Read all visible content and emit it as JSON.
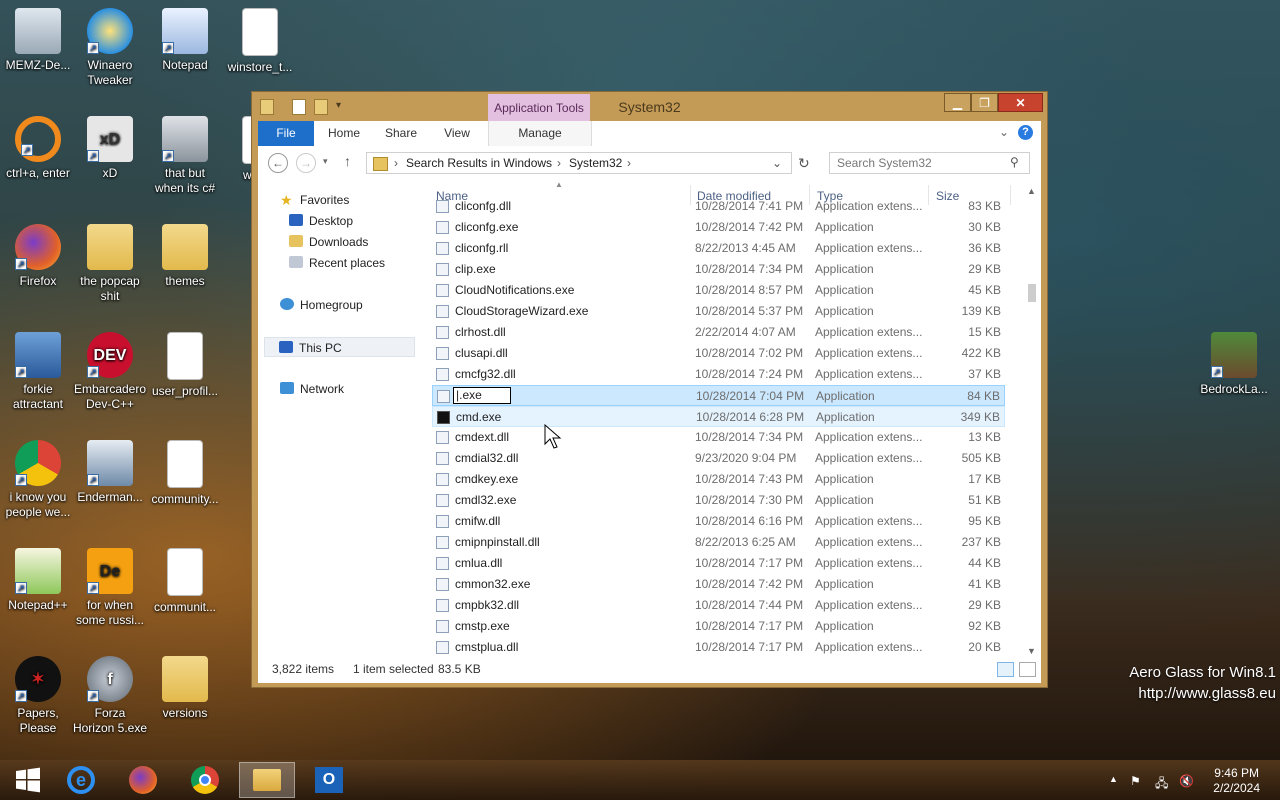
{
  "desktop": {
    "icons": [
      {
        "label": "MEMZ-De...",
        "icon": "recycle-bin-icon"
      },
      {
        "label": "Winaero\nTweaker",
        "icon": "winaero-icon"
      },
      {
        "label": "Notepad",
        "icon": "notepad-icon"
      },
      {
        "label": "winstore_t...",
        "icon": "document-icon"
      },
      {
        "label": "ctrl+a, enter",
        "icon": "orange-app-icon"
      },
      {
        "label": "xD",
        "icon": "hxd-icon"
      },
      {
        "label": "that but\nwhen its c#",
        "icon": "window-stack-icon"
      },
      {
        "label": "wins...",
        "icon": "document-icon"
      },
      {
        "label": "Firefox",
        "icon": "firefox-icon"
      },
      {
        "label": "the popcap\nshit",
        "icon": "folder-icon"
      },
      {
        "label": "themes",
        "icon": "folder-icon"
      },
      {
        "label": "forkie\nattractant",
        "icon": "network-settings-icon"
      },
      {
        "label": "Embarcadero\nDev-C++",
        "icon": "devcpp-icon"
      },
      {
        "label": "user_profil...",
        "icon": "document-icon"
      },
      {
        "label": "i know you\npeople we...",
        "icon": "chrome-icon"
      },
      {
        "label": "Enderman...",
        "icon": "window-app-icon"
      },
      {
        "label": "community...",
        "icon": "document-icon"
      },
      {
        "label": "Notepad++",
        "icon": "notepadpp-icon"
      },
      {
        "label": "for when\nsome russi...",
        "icon": "de-icon"
      },
      {
        "label": "communit...",
        "icon": "document-icon"
      },
      {
        "label": "Papers,\nPlease",
        "icon": "papers-please-icon"
      },
      {
        "label": "Forza\nHorizon 5.exe",
        "icon": "flash-icon"
      },
      {
        "label": "versions",
        "icon": "folder-icon"
      },
      {
        "label": "BedrockLa...",
        "icon": "minecraft-icon"
      }
    ],
    "watermark": [
      "Aero Glass for Win8.1",
      "http://www.glass8.eu"
    ]
  },
  "window": {
    "title": "System32",
    "context_tab": "Application Tools",
    "ribbon_tabs": [
      "File",
      "Home",
      "Share",
      "View",
      "Manage"
    ],
    "address": {
      "crumbs": [
        "Search Results in Windows",
        "System32"
      ]
    },
    "search_placeholder": "Search System32",
    "nav": {
      "favorites": "Favorites",
      "desktop": "Desktop",
      "downloads": "Downloads",
      "recent": "Recent places",
      "homegroup": "Homegroup",
      "thispc": "This PC",
      "network": "Network"
    },
    "columns": {
      "name": "Name",
      "date": "Date modified",
      "type": "Type",
      "size": "Size"
    },
    "files": [
      {
        "name": "cliconfg.dll",
        "date": "10/28/2014 7:41 PM",
        "type": "Application extens...",
        "size": "83 KB"
      },
      {
        "name": "cliconfg.exe",
        "date": "10/28/2014 7:42 PM",
        "type": "Application",
        "size": "30 KB"
      },
      {
        "name": "cliconfg.rll",
        "date": "8/22/2013 4:45 AM",
        "type": "Application extens...",
        "size": "36 KB"
      },
      {
        "name": "clip.exe",
        "date": "10/28/2014 7:34 PM",
        "type": "Application",
        "size": "29 KB"
      },
      {
        "name": "CloudNotifications.exe",
        "date": "10/28/2014 8:57 PM",
        "type": "Application",
        "size": "45 KB"
      },
      {
        "name": "CloudStorageWizard.exe",
        "date": "10/28/2014 5:37 PM",
        "type": "Application",
        "size": "139 KB"
      },
      {
        "name": "clrhost.dll",
        "date": "2/22/2014 4:07 AM",
        "type": "Application extens...",
        "size": "15 KB"
      },
      {
        "name": "clusapi.dll",
        "date": "10/28/2014 7:02 PM",
        "type": "Application extens...",
        "size": "422 KB"
      },
      {
        "name": "cmcfg32.dll",
        "date": "10/28/2014 7:24 PM",
        "type": "Application extens...",
        "size": "37 KB"
      },
      {
        "name": "|.exe",
        "date": "10/28/2014 7:04 PM",
        "type": "Application",
        "size": "84 KB"
      },
      {
        "name": "cmd.exe",
        "date": "10/28/2014 6:28 PM",
        "type": "Application",
        "size": "349 KB"
      },
      {
        "name": "cmdext.dll",
        "date": "10/28/2014 7:34 PM",
        "type": "Application extens...",
        "size": "13 KB"
      },
      {
        "name": "cmdial32.dll",
        "date": "9/23/2020 9:04 PM",
        "type": "Application extens...",
        "size": "505 KB"
      },
      {
        "name": "cmdkey.exe",
        "date": "10/28/2014 7:43 PM",
        "type": "Application",
        "size": "17 KB"
      },
      {
        "name": "cmdl32.exe",
        "date": "10/28/2014 7:30 PM",
        "type": "Application",
        "size": "51 KB"
      },
      {
        "name": "cmifw.dll",
        "date": "10/28/2014 6:16 PM",
        "type": "Application extens...",
        "size": "95 KB"
      },
      {
        "name": "cmipnpinstall.dll",
        "date": "8/22/2013 6:25 AM",
        "type": "Application extens...",
        "size": "237 KB"
      },
      {
        "name": "cmlua.dll",
        "date": "10/28/2014 7:17 PM",
        "type": "Application extens...",
        "size": "44 KB"
      },
      {
        "name": "cmmon32.exe",
        "date": "10/28/2014 7:42 PM",
        "type": "Application",
        "size": "41 KB"
      },
      {
        "name": "cmpbk32.dll",
        "date": "10/28/2014 7:44 PM",
        "type": "Application extens...",
        "size": "29 KB"
      },
      {
        "name": "cmstp.exe",
        "date": "10/28/2014 7:17 PM",
        "type": "Application",
        "size": "92 KB"
      },
      {
        "name": "cmstplua.dll",
        "date": "10/28/2014 7:17 PM",
        "type": "Application extens...",
        "size": "20 KB"
      }
    ],
    "selected_index": 9,
    "hover_index": 10,
    "status": {
      "count": "3,822 items",
      "selection": "1 item selected",
      "size": "83.5 KB"
    }
  },
  "taskbar": {
    "time": "9:46 PM",
    "date": "2/2/2024"
  },
  "colors": {
    "file_tab": "#1e6fc9",
    "selection": "#cce8ff",
    "close_button": "#c7432d",
    "app_tools": "#e4c0e0"
  }
}
